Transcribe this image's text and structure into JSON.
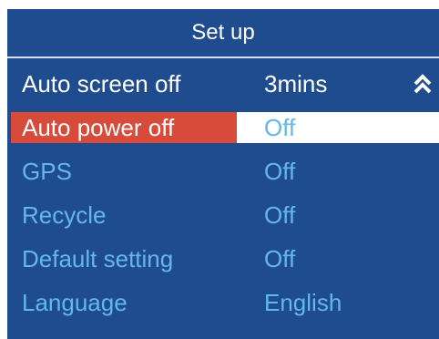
{
  "header": {
    "title": "Set up"
  },
  "menu": {
    "items": [
      {
        "label": "Auto screen off",
        "value": "3mins"
      },
      {
        "label": "Auto power off",
        "value": "Off"
      },
      {
        "label": "GPS",
        "value": "Off"
      },
      {
        "label": "Recycle",
        "value": "Off"
      },
      {
        "label": "Default setting",
        "value": "Off"
      },
      {
        "label": "Language",
        "value": "English"
      }
    ],
    "selected_index": 1
  },
  "icons": {
    "scroll_up": "double-chevron-up-icon"
  },
  "colors": {
    "background": "#1f4c8f",
    "text_default": "#63b8e8",
    "text_highlight": "#ffffff",
    "selected_label_bg": "#d84a3a",
    "selected_value_bg": "#ffffff"
  }
}
